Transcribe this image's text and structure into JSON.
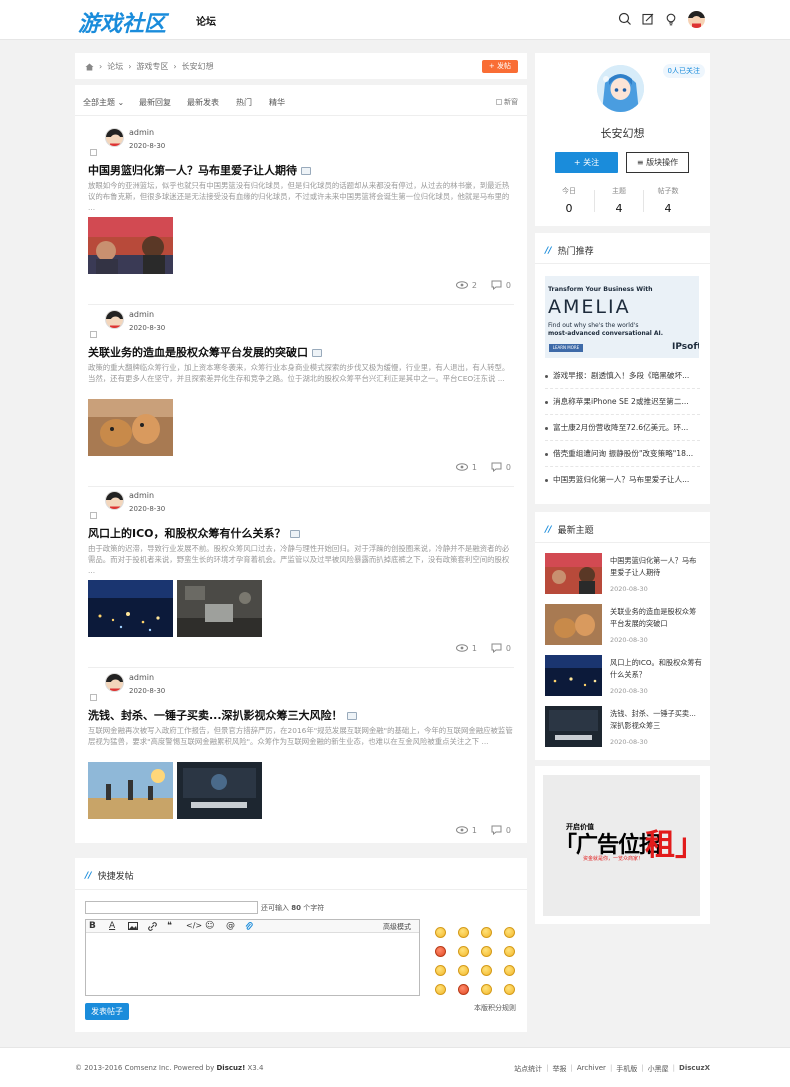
{
  "header": {
    "logo": "游戏社区",
    "nav": "论坛"
  },
  "breadcrumb": {
    "items": [
      "论坛",
      "游戏专区",
      "长安幻想"
    ],
    "separator": "›",
    "post_button": "+ 发帖"
  },
  "tabs": {
    "items": [
      "全部主题 ⌄",
      "最新回复",
      "最新发表",
      "热门",
      "精华"
    ],
    "new_window": "新窗"
  },
  "threads": [
    {
      "user": "admin",
      "date": "2020-8-30",
      "title": "中国男篮归化第一人？马布里爱子让人期待",
      "summary": "放眼如今的亚洲篮坛，似乎也就只有中国男篮没有归化球员，但是归化球员的话题却从来都没有停过，从过去的林书豪，到最近热议的布鲁克斯，但很多球迷还是无法接受没有血缘的归化球员，不过或许未来中国男篮将会诞生第一位归化球员，他就是马布里的 ...",
      "views": "2",
      "replies": "0"
    },
    {
      "user": "admin",
      "date": "2020-8-30",
      "title": "关联业务的造血是股权众筹平台发展的突破口",
      "summary": "政策的重大翻牌临众筹行业，加上资本寒冬袭来，众筹行业本身商业模式探索的步伐又极为缓慢，行业里，有人退出，有人转型。当然，还有更多人在坚守，并且探索差异化生存和竞争之路。位于湖北的股权众筹平台兴汇利正是其中之一。平台CEO汪东说 ...",
      "views": "1",
      "replies": "0"
    },
    {
      "user": "admin",
      "date": "2020-8-30",
      "title": "风口上的ICO，和股权众筹有什么关系？",
      "summary": "由于政策的迟滞，导致行业发展不前。股权众筹风口过去，冷静与理性开始回归。对于浮躁的创投圈来说，冷静并不是融资者的必需品。而对于投机者来说，野蛮生长的环境才孕育着机会。严监管以及过早被风险暴露而扒掉底裤之下，没有政策套利空间的股权 ...",
      "views": "1",
      "replies": "0"
    },
    {
      "user": "admin",
      "date": "2020-8-30",
      "title": "洗钱、封杀、一锤子买卖...深扒影视众筹三大风险！",
      "summary": "互联网金融再次被写入政府工作报告，但景官方措辞严厉，在2016年\"规范发展互联网金融\"的基础上，今年的互联网金融应被监管层视为猛兽，要求\"高度警惕互联网金融累积风险\"。众筹作为互联网金融的新生业态，也难以在互金风险被重点关注之下 ...",
      "views": "1",
      "replies": "0"
    }
  ],
  "quick_post": {
    "title": "快捷发帖",
    "remaining_prefix": "还可输入",
    "remaining_count": "80",
    "remaining_suffix": "个字符",
    "advanced_mode": "高级模式",
    "submit": "发表帖子",
    "rules": "本版积分规则"
  },
  "forum": {
    "followers": "0人已关注",
    "name": "长安幻想",
    "follow_button": "+ 关注",
    "ops_button": "≡ 版块操作",
    "stats": [
      {
        "label": "今日",
        "value": "0"
      },
      {
        "label": "主题",
        "value": "4"
      },
      {
        "label": "帖子数",
        "value": "4"
      }
    ]
  },
  "hot": {
    "title": "热门推荐",
    "ad": {
      "headline": "Transform Your Business With",
      "brand": "AMELIA",
      "sub1": "Find out why she's the world's",
      "sub2": "most-advanced conversational AI.",
      "button": "LEARN MORE",
      "vendor": "IPsoft"
    },
    "items": [
      "游戏早报：剧透慎入！多段《暗黑破坏...",
      "消息称苹果iPhone SE 2或推迟至第二...",
      "富士康2月份营收降至72.6亿美元。环...",
      "借壳重组遭问询 振静股份\"改变策略\"18...",
      "中国男篮归化第一人？马布里爱子让人..."
    ]
  },
  "latest": {
    "title": "最新主题",
    "items": [
      {
        "title": "中国男篮归化第一人？马布里爱子让人期待",
        "date": "2020-08-30"
      },
      {
        "title": "关联业务的造血是股权众筹平台发展的突破口",
        "date": "2020-08-30"
      },
      {
        "title": "风口上的ICO。和股权众筹有什么关系？",
        "date": "2020-08-30"
      },
      {
        "title": "洗钱、封杀、一锤子买卖...深扒影视众筹三",
        "date": "2020-08-30"
      }
    ]
  },
  "adbox": {
    "top": "开启价值",
    "word": "「广告位招",
    "big": "租」",
    "sub": "资金就是你，一览众商家！"
  },
  "footer": {
    "copyright_prefix": "© 2013-2016 Comsenz Inc. Powered by",
    "brand": "Discuz!",
    "version": "X3.4",
    "links": [
      "站点统计",
      "举报",
      "Archiver",
      "手机版",
      "小黑屋",
      "DiscuzX"
    ]
  },
  "colors": {
    "accent": "#1a8cdb",
    "post_button": "#f96d35"
  }
}
